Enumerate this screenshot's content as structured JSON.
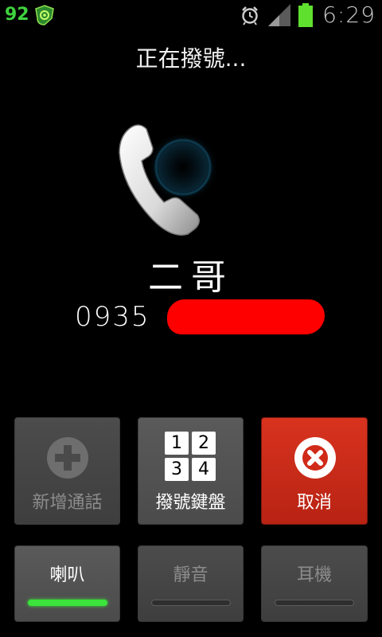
{
  "status_bar": {
    "battery_percent": "92",
    "app_icon": "shield-app-icon",
    "alarm_icon": "alarm-clock-icon",
    "signal_icon": "signal-icon",
    "battery_icon": "battery-icon",
    "time": "6:29",
    "battery_color": "#3fd13f"
  },
  "call": {
    "status": "正在撥號...",
    "contact_name": "二哥",
    "number_prefix": "0935",
    "handset_icon": "phone-handset-icon"
  },
  "buttons": {
    "add_call": {
      "label": "新增通話",
      "icon": "plus-circle-icon"
    },
    "keypad": {
      "label": "撥號鍵盤",
      "keys": [
        "1",
        "2",
        "3",
        "4"
      ]
    },
    "cancel": {
      "label": "取消",
      "icon": "x-circle-icon",
      "color": "#c82a18"
    },
    "speaker": {
      "label": "喇叭",
      "on": true,
      "indicator_color": "#3be33b"
    },
    "mute": {
      "label": "靜音",
      "on": false
    },
    "headset": {
      "label": "耳機",
      "on": false
    }
  }
}
